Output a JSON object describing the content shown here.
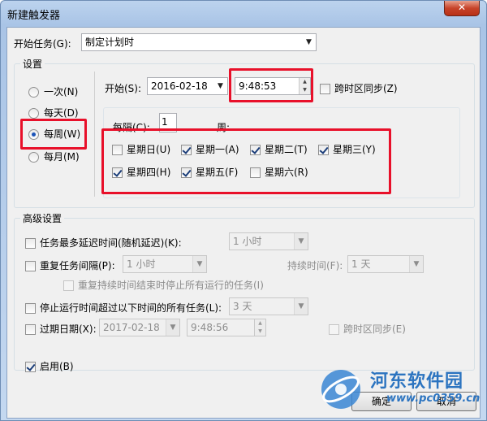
{
  "window": {
    "title": "新建触发器",
    "close_glyph": "✕"
  },
  "begin_task": {
    "label": "开始任务(G):",
    "value": "制定计划时"
  },
  "settings": {
    "group_label": "设置",
    "radios": [
      {
        "label": "一次(N)",
        "checked": false
      },
      {
        "label": "每天(D)",
        "checked": false
      },
      {
        "label": "每周(W)",
        "checked": true
      },
      {
        "label": "每月(M)",
        "checked": false
      }
    ],
    "start_label": "开始(S):",
    "start_date": "2016-02-18",
    "start_time": "9:48:53",
    "sync_timezone": "跨时区同步(Z)",
    "recur_label": "每隔(C):",
    "recur_value": "1",
    "recur_unit": "周:",
    "days": [
      {
        "label": "星期日(U)",
        "checked": false
      },
      {
        "label": "星期一(A)",
        "checked": true
      },
      {
        "label": "星期二(T)",
        "checked": true
      },
      {
        "label": "星期三(Y)",
        "checked": true
      },
      {
        "label": "星期四(H)",
        "checked": true
      },
      {
        "label": "星期五(F)",
        "checked": true
      },
      {
        "label": "星期六(R)",
        "checked": false
      }
    ]
  },
  "advanced": {
    "group_label": "高级设置",
    "delay_label": "任务最多延迟时间(随机延迟)(K):",
    "delay_value": "1 小时",
    "repeat_label": "重复任务间隔(P):",
    "repeat_value": "1 小时",
    "duration_label": "持续时间(F):",
    "duration_value": "1 天",
    "stop_at_end_label": "重复持续时间结束时停止所有运行的任务(I)",
    "stop_long_label": "停止运行时间超过以下时间的所有任务(L):",
    "stop_long_value": "3 天",
    "expire_label": "过期日期(X):",
    "expire_date": "2017-02-18",
    "expire_time": "9:48:56",
    "expire_sync": "跨时区同步(E)"
  },
  "enabled": {
    "label": "启用(B)",
    "checked": true
  },
  "buttons": {
    "ok": "确定",
    "cancel": "取消"
  },
  "watermark": {
    "name": "河东软件园",
    "url": "www.pc0359.cn"
  }
}
